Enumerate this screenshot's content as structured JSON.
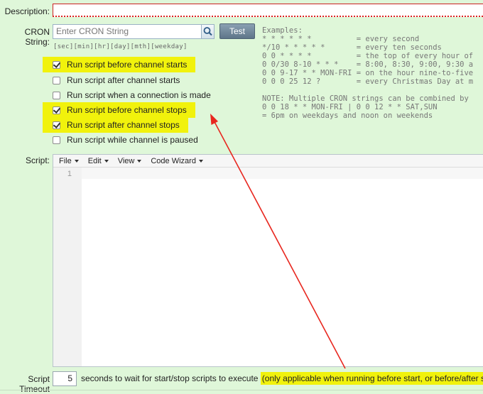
{
  "description": {
    "label": "Description:",
    "value": ""
  },
  "cron": {
    "label": "CRON String:",
    "placeholder": "Enter CRON String",
    "test_label": "Test",
    "help": "[sec][min][hr][day][mth][weekday]",
    "examples": [
      "Examples:",
      "* * * * * *          = every second",
      "*/10 * * * * *       = every ten seconds",
      "0 0 * * * *          = the top of every hour of",
      "0 0/30 8-10 * * *    = 8:00, 8:30, 9:00, 9:30 a",
      "0 0 9-17 * * MON-FRI = on the hour nine-to-five",
      "0 0 0 25 12 ?        = every Christmas Day at m",
      "",
      "NOTE: Multiple CRON strings can be combined by",
      "0 0 18 * * MON-FRI | 0 0 12 * * SAT,SUN",
      "= 6pm on weekdays and noon on weekends"
    ]
  },
  "checkboxes": [
    {
      "label": "Run script before channel starts",
      "checked": true,
      "highlighted": true
    },
    {
      "label": "Run script after channel starts",
      "checked": false,
      "highlighted": false
    },
    {
      "label": "Run script when a connection is made",
      "checked": false,
      "highlighted": false
    },
    {
      "label": "Run script before channel stops",
      "checked": true,
      "highlighted": true
    },
    {
      "label": "Run script after channel stops",
      "checked": true,
      "highlighted": true
    },
    {
      "label": "Run script while channel is paused",
      "checked": false,
      "highlighted": false
    }
  ],
  "script": {
    "label": "Script:",
    "menus": [
      "File",
      "Edit",
      "View",
      "Code Wizard"
    ],
    "line_numbers": [
      "1"
    ]
  },
  "timeout": {
    "label": "Script Timeout",
    "value": "5",
    "suffix": "seconds to wait for start/stop scripts to execute",
    "note": "(only applicable when running before start, or before/after stop)"
  },
  "colors": {
    "background": "#dff7d9",
    "highlight": "#f1f20c",
    "annotation_arrow": "#e8271f"
  }
}
